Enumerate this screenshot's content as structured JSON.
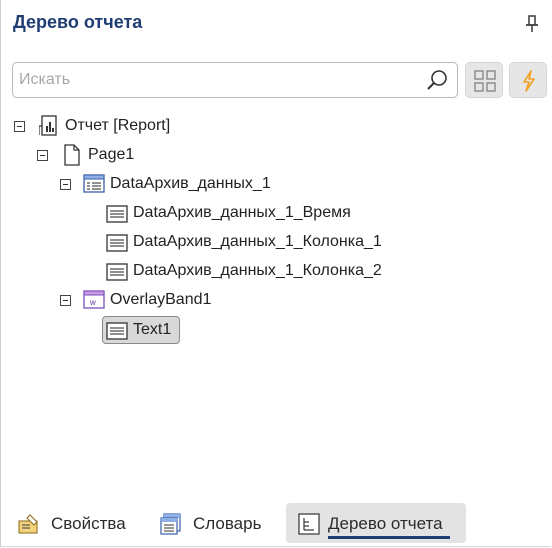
{
  "panel": {
    "title": "Дерево отчета",
    "pin_icon": "pin-icon"
  },
  "search": {
    "placeholder": "Искать",
    "value": "",
    "icon": "search-icon"
  },
  "toolbar": {
    "grid_icon": "grid-icon",
    "flash_icon": "lightning-icon",
    "flash_color": "#f0a020"
  },
  "tree": [
    {
      "label": "Отчет [Report]",
      "icon": "report-icon",
      "expanded": true
    },
    {
      "label": "Page1",
      "icon": "page-icon",
      "expanded": true
    },
    {
      "label": "DataАрхив_данных_1",
      "icon": "databand-icon",
      "expanded": true
    },
    {
      "label": "DataАрхив_данных_1_Время",
      "icon": "text-icon"
    },
    {
      "label": "DataАрхив_данных_1_Колонка_1",
      "icon": "text-icon"
    },
    {
      "label": "DataАрхив_данных_1_Колонка_2",
      "icon": "text-icon"
    },
    {
      "label": "OverlayBand1",
      "icon": "overlayband-icon",
      "expanded": true
    },
    {
      "label": "Text1",
      "icon": "text-icon",
      "selected": true
    }
  ],
  "tabs": [
    {
      "label": "Свойства",
      "icon": "properties-icon"
    },
    {
      "label": "Словарь",
      "icon": "dictionary-icon"
    },
    {
      "label": "Дерево отчета",
      "icon": "report-tree-icon",
      "active": true
    }
  ],
  "colors": {
    "accent": "#1f3d73",
    "selected_bg": "#d9d9d9"
  }
}
